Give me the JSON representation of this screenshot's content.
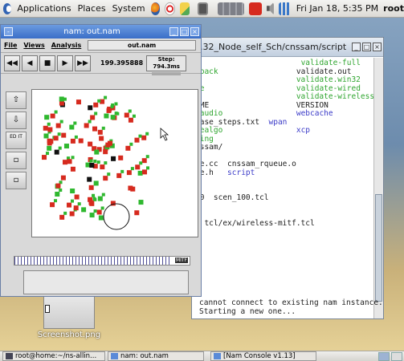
{
  "top_panel": {
    "menus": [
      "Applications",
      "Places",
      "System"
    ],
    "clock": "Fri Jan 18, 5:35 PM",
    "user": "root"
  },
  "terminal": {
    "title": ".32_Node_self_Sch/cnssam/script",
    "lines": [
      [
        {
          "t": "",
          "c": "plain"
        },
        {
          "t": "                      validate-full",
          "c": "green"
        }
      ],
      [
        {
          "t": "hback                 ",
          "c": "green"
        },
        {
          "t": "validate.out",
          "c": "plain"
        }
      ],
      [
        {
          "t": "                      validate.win32",
          "c": "green"
        }
      ],
      [
        {
          "t": "ue                    ",
          "c": "green"
        },
        {
          "t": "validate-wired",
          "c": "green"
        }
      ],
      [
        {
          "t": "                      validate-wireless",
          "c": "green"
        }
      ],
      [
        {
          "t": "DME                   VERSION",
          "c": "plain"
        }
      ],
      [
        {
          "t": "laudio                ",
          "c": "green"
        },
        {
          "t": "webcache",
          "c": "blue"
        }
      ],
      [
        {
          "t": "ease_steps.txt  ",
          "c": "plain"
        },
        {
          "t": "wpan",
          "c": "blue"
        }
      ],
      [
        {
          "t": "tealgo                ",
          "c": "green"
        },
        {
          "t": "xcp",
          "c": "blue"
        }
      ],
      [
        {
          "t": "ting",
          "c": "green"
        }
      ],
      [
        {
          "t": "nssam/",
          "c": "plain"
        }
      ],
      [
        {
          "t": "",
          "c": "plain"
        }
      ],
      [
        {
          "t": "ue.cc  cnssam_rqueue.o",
          "c": "plain"
        }
      ],
      [
        {
          "t": "ue.h   ",
          "c": "plain"
        },
        {
          "t": "script",
          "c": "blue"
        }
      ],
      [
        {
          "t": "",
          "c": "plain"
        }
      ],
      [
        {
          "t": "",
          "c": "plain"
        }
      ],
      [
        {
          "t": "00  scen_100.tcl",
          "c": "plain"
        }
      ],
      [
        {
          "t": "",
          "c": "plain"
        }
      ],
      [
        {
          "t": "",
          "c": "plain"
        }
      ],
      [
        {
          "t": "n tcl/ex/wireless-mitf.tcl",
          "c": "plain"
        }
      ]
    ],
    "output": "cannot connect to existing nam instance. Starting a new one..."
  },
  "nam": {
    "title": "nam: out.nam",
    "menu": [
      "File",
      "Views",
      "Analysis"
    ],
    "file_label": "out.nam",
    "time": "199.395888",
    "step": "Step: 794.3ms",
    "side_buttons": [
      "ED IT"
    ],
    "timeline_label": "MITF"
  },
  "desktop": {
    "file_label": "Screenshot.png"
  },
  "taskbar": {
    "items": [
      "root@home:~/ns-allin...",
      "nam: out.nam",
      "[Nam Console v1.13]"
    ]
  }
}
